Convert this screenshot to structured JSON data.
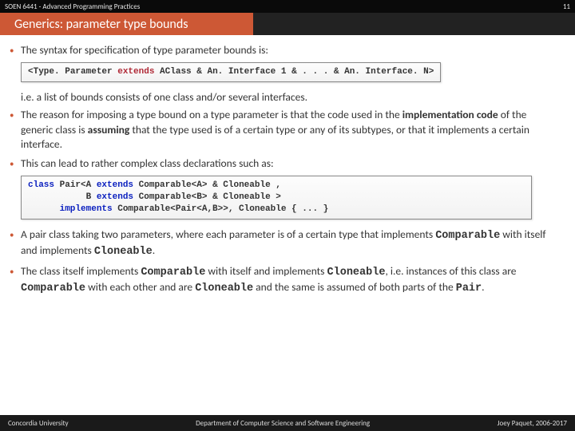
{
  "header": {
    "course": "SOEN 6441 - Advanced Programming Practices",
    "page_num": "11"
  },
  "title": "Generics: parameter type bounds",
  "bullets": {
    "b1": "The syntax for specification of type parameter bounds is:",
    "b1_after": "i.e. a list of bounds consists of one class and/or several interfaces.",
    "b2_a": "The reason for imposing a type bound on a type parameter is that the code used in the ",
    "b2_b": "implementation code",
    "b2_c": " of the generic class is ",
    "b2_d": "assuming",
    "b2_e": " that the type used is of a certain type or any of its subtypes, or that it implements a certain interface.",
    "b3": "This can lead to rather complex class declarations such as:",
    "b4_a": "A pair class taking two parameters, where each parameter is of a certain type that implements ",
    "b4_b": "Comparable",
    "b4_c": " with itself and implements ",
    "b4_d": "Cloneable",
    "b4_e": ".",
    "b5_a": "The class itself implements ",
    "b5_b": "Comparable",
    "b5_c": " with itself and implements ",
    "b5_d": "Cloneable",
    "b5_e": ", i.e. instances of this class are ",
    "b5_f": "Comparable",
    "b5_g": " with each other and are ",
    "b5_h": "Cloneable",
    "b5_i": " and the same is assumed of both parts of the ",
    "b5_j": "Pair",
    "b5_k": "."
  },
  "code1": {
    "lt": "<",
    "tp": "Type. Parameter ",
    "ext": "extends",
    "rest": " AClass & An. Interface 1 & . . . & An. Interface. N",
    "gt": ">"
  },
  "code2": {
    "l1a": "class",
    "l1b": " Pair<A ",
    "l1c": "extends",
    "l1d": " Comparable<A> & Cloneable ,",
    "l2a": "           B ",
    "l2b": "extends",
    "l2c": " Comparable<B> & Cloneable >",
    "l3a": "      ",
    "l3b": "implements",
    "l3c": " Comparable<Pair<A,B>>, Cloneable { ... }"
  },
  "footer": {
    "left": "Concordia University",
    "center": "Department of Computer Science and Software Engineering",
    "right": "Joey Paquet, 2006-2017"
  }
}
